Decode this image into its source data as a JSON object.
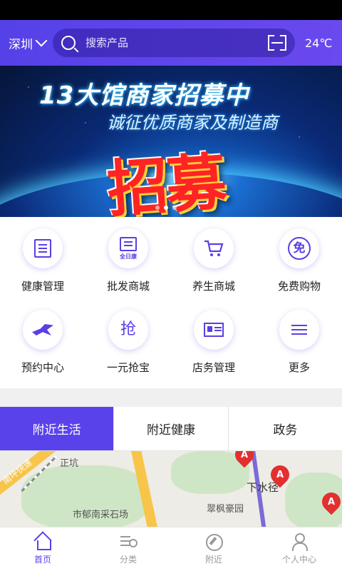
{
  "header": {
    "city": "深圳",
    "search_placeholder": "搜索产品",
    "weather": "24℃",
    "icons": {
      "city_dropdown": "chevron-down-icon",
      "search": "search-icon",
      "scan": "scan-icon"
    }
  },
  "banner": {
    "line1": "13大馆商家招募中",
    "line2": "诚征优质商家及制造商",
    "headline": "招募",
    "dots": 3,
    "active_dot": 1
  },
  "services": [
    {
      "label": "健康管理",
      "icon": "document-icon"
    },
    {
      "label": "批发商城",
      "icon": "wholesale-icon",
      "icon_text": "全日康"
    },
    {
      "label": "养生商城",
      "icon": "cart-icon"
    },
    {
      "label": "免费购物",
      "icon": "free-icon",
      "icon_text": "免"
    },
    {
      "label": "预约中心",
      "icon": "appointment-icon"
    },
    {
      "label": "一元抢宝",
      "icon": "grab-icon",
      "icon_text": "抢"
    },
    {
      "label": "店务管理",
      "icon": "store-card-icon"
    },
    {
      "label": "更多",
      "icon": "list-icon"
    }
  ],
  "tabs": [
    {
      "label": "附近生活",
      "active": true
    },
    {
      "label": "附近健康",
      "active": false
    },
    {
      "label": "政务",
      "active": false
    }
  ],
  "map": {
    "places": [
      "正坑",
      "市郁南采石场",
      "下水径",
      "翠枫豪园"
    ],
    "road_label": "南坪快速",
    "pin_letter": "A"
  },
  "bottom_nav": [
    {
      "label": "首页",
      "icon": "home-icon",
      "active": true
    },
    {
      "label": "分类",
      "icon": "category-icon",
      "active": false
    },
    {
      "label": "附近",
      "icon": "compass-icon",
      "active": false
    },
    {
      "label": "个人中心",
      "icon": "user-icon",
      "active": false
    }
  ],
  "colors": {
    "primary": "#5a42ea",
    "header_gradient_start": "#5541e8",
    "header_gradient_end": "#6a49ee"
  }
}
